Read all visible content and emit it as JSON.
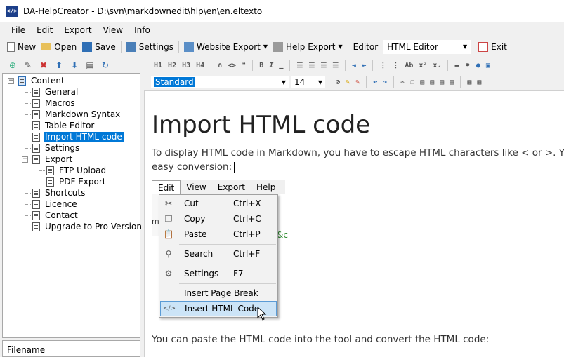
{
  "window": {
    "title": "DA-HelpCreator - D:\\svn\\markdownedit\\hlp\\en\\en.eltexto",
    "icon": "</>"
  },
  "menubar": [
    "File",
    "Edit",
    "Export",
    "View",
    "Info"
  ],
  "toolbar": {
    "new": "New",
    "open": "Open",
    "save": "Save",
    "settings": "Settings",
    "website_export": "Website Export",
    "help_export": "Help Export",
    "editor_label": "Editor",
    "editor_value": "HTML Editor",
    "exit": "Exit"
  },
  "tree": {
    "root": "Content",
    "items": [
      "General",
      "Macros",
      "Markdown Syntax",
      "Table Editor",
      "Import HTML code",
      "Settings",
      "Export",
      "FTP Upload",
      "PDF Export",
      "Shortcuts",
      "Licence",
      "Contact",
      "Upgrade to Pro Version"
    ],
    "selected": "Import HTML code"
  },
  "filename_label": "Filename",
  "format_toolbar": [
    "H1",
    "H2",
    "H3",
    "H4",
    "∩",
    "<>",
    "❝",
    "B",
    "I"
  ],
  "style_toolbar": {
    "style": "Standard",
    "size": "14"
  },
  "document": {
    "title": "Import HTML code",
    "para1_line1": "To display HTML code in Markdown, you have to escape HTML characters like < or >. You ca",
    "para1_line2": "easy conversion:",
    "para2": "You can paste the HTML code into the tool and convert the HTML code:"
  },
  "screenshot": {
    "menus": [
      "Edit",
      "View",
      "Export",
      "Help"
    ],
    "under_text": "m",
    "green_text": "&c",
    "dropdown": [
      {
        "icon": "scissors-icon",
        "glyph": "✂",
        "label": "Cut",
        "shortcut": "Ctrl+X"
      },
      {
        "icon": "copy-icon",
        "glyph": "❐",
        "label": "Copy",
        "shortcut": "Ctrl+C"
      },
      {
        "icon": "paste-icon",
        "glyph": "📋",
        "label": "Paste",
        "shortcut": "Ctrl+P"
      },
      {
        "icon": "search-icon",
        "glyph": "⚲",
        "label": "Search",
        "shortcut": "Ctrl+F"
      },
      {
        "icon": "settings-icon",
        "glyph": "⚙",
        "label": "Settings",
        "shortcut": "F7"
      },
      {
        "icon": "",
        "glyph": "",
        "label": "Insert Page Break",
        "shortcut": ""
      },
      {
        "icon": "html-code-icon",
        "glyph": "</>",
        "label": "Insert HTML Code",
        "shortcut": ""
      }
    ]
  }
}
